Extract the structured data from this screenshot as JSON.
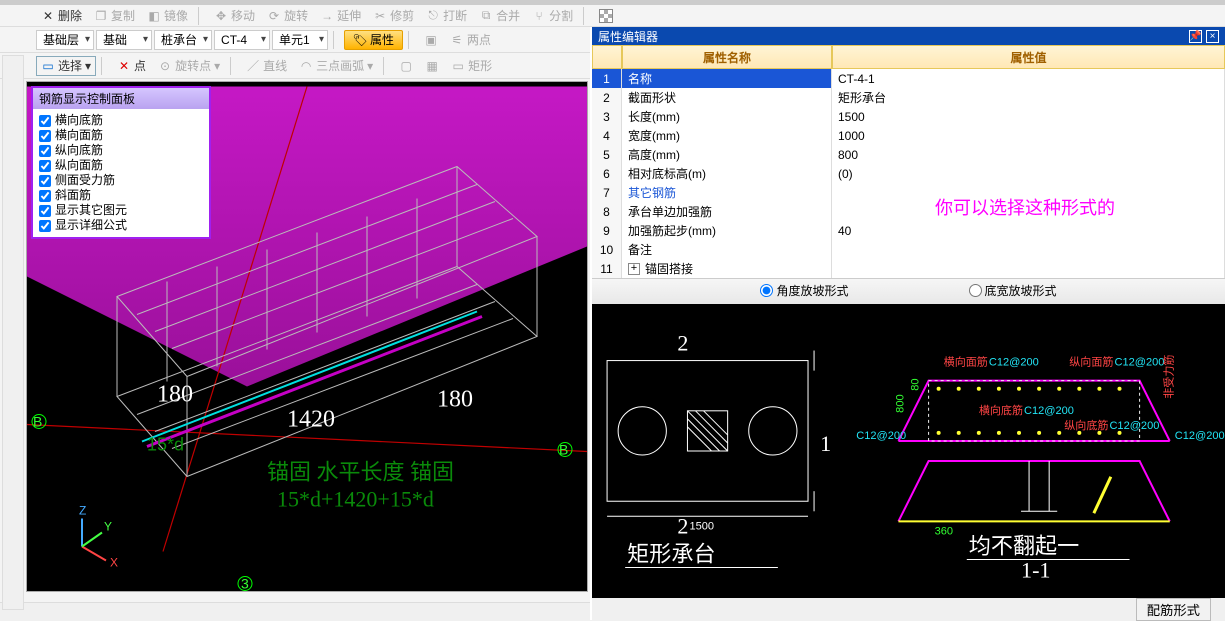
{
  "toolbar1": {
    "delete": "删除",
    "copy": "复制",
    "mirror": "镜像",
    "move": "移动",
    "rotate": "旋转",
    "extend": "延伸",
    "trim": "修剪",
    "break": "打断",
    "merge": "合并",
    "split": "分割"
  },
  "toolbar2": {
    "dd1": "基础层",
    "dd2": "基础",
    "dd3": "桩承台",
    "dd4": "CT-4",
    "dd5": "单元1",
    "attr": "属性",
    "twoPoints": "两点"
  },
  "toolbar3": {
    "select": "选择",
    "point": "点",
    "rotPoint": "旋转点",
    "line": "直线",
    "arc3": "三点画弧",
    "rect": "矩形"
  },
  "rebarPanel": {
    "title": "钢筋显示控制面板",
    "items": [
      "横向底筋",
      "横向面筋",
      "纵向底筋",
      "纵向面筋",
      "侧面受力筋",
      "斜面筋",
      "显示其它图元",
      "显示详细公式"
    ]
  },
  "viewport": {
    "d180a": "180",
    "d1420": "1420",
    "d180b": "180",
    "formula1": "锚固 水平长度 锚固",
    "formula2": "15*d+1420+15*d",
    "bL": "B",
    "bR": "B",
    "node3": "3",
    "axZ": "Z",
    "axY": "Y",
    "axX": "X",
    "expr": "15*d"
  },
  "prop": {
    "title": "属性编辑器",
    "colName": "属性名称",
    "colVal": "属性值",
    "rows": [
      {
        "i": "1",
        "n": "名称",
        "v": "CT-4-1",
        "sel": true
      },
      {
        "i": "2",
        "n": "截面形状",
        "v": "矩形承台"
      },
      {
        "i": "3",
        "n": "长度(mm)",
        "v": "1500"
      },
      {
        "i": "4",
        "n": "宽度(mm)",
        "v": "1000"
      },
      {
        "i": "5",
        "n": "高度(mm)",
        "v": "800"
      },
      {
        "i": "6",
        "n": "相对底标高(m)",
        "v": "(0)"
      },
      {
        "i": "7",
        "n": "其它钢筋",
        "v": "",
        "link": true
      },
      {
        "i": "8",
        "n": "承台单边加强筋",
        "v": ""
      },
      {
        "i": "9",
        "n": "加强筋起步(mm)",
        "v": "40"
      },
      {
        "i": "10",
        "n": "备注",
        "v": ""
      },
      {
        "i": "11",
        "n": "锚固搭接",
        "v": "",
        "expand": true
      }
    ],
    "note": "你可以选择这种形式的"
  },
  "radio": {
    "r1": "角度放坡形式",
    "r2": "底宽放坡形式"
  },
  "diagram": {
    "top2": "2",
    "right1": "1",
    "bot2": "2",
    "w": "1500",
    "h": "800",
    "h80": "80",
    "lblRect": "矩形承台",
    "lblSec": "均不翻起一",
    "lblSecSub": "1-1",
    "t_hm": "横向面筋",
    "t_hmv": "C12@200",
    "t_zm": "纵向面筋",
    "t_zmv": "C12@200",
    "t_hd": "横向底筋",
    "t_hdv": "C12@200",
    "t_zd": "纵向底筋",
    "t_zdv": "C12@200",
    "t_cl": "C12@200",
    "t_cr": "C12@200",
    "v360": "360",
    "btn": "配筋形式",
    "reinf": "非受力筋"
  }
}
